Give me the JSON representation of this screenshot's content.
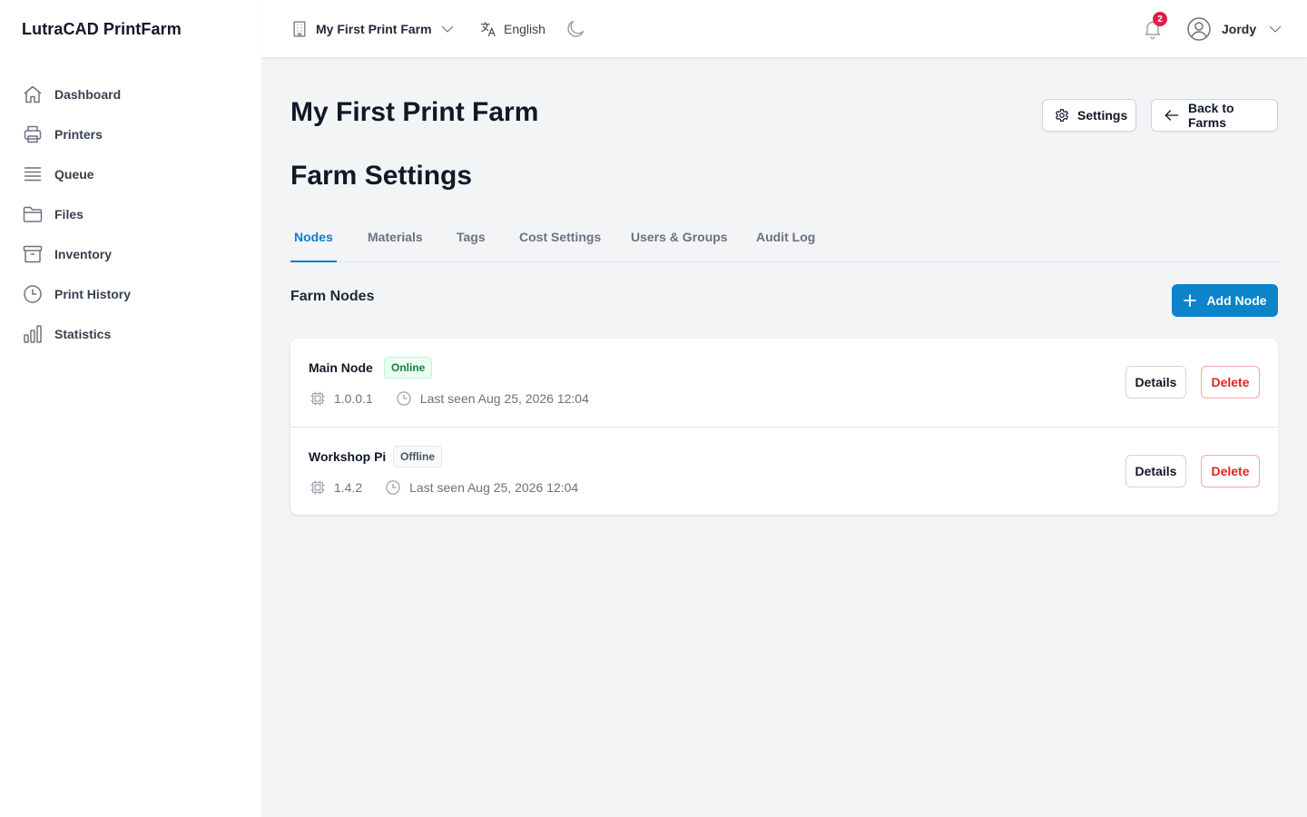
{
  "app": {
    "title": "LutraCAD PrintFarm"
  },
  "sidebar": {
    "items": [
      {
        "label": "Dashboard",
        "icon": "home-icon"
      },
      {
        "label": "Printers",
        "icon": "printer-icon"
      },
      {
        "label": "Queue",
        "icon": "queue-icon"
      },
      {
        "label": "Files",
        "icon": "folder-icon"
      },
      {
        "label": "Inventory",
        "icon": "archive-icon"
      },
      {
        "label": "Print History",
        "icon": "clock-icon"
      },
      {
        "label": "Statistics",
        "icon": "bar-chart-icon"
      }
    ]
  },
  "topbar": {
    "farm_selector": "My First Print Farm",
    "language": "English",
    "notifications_count": "2",
    "user_name": "Jordy"
  },
  "page": {
    "title": "My First Print Farm",
    "settings_label": "Settings",
    "back_label": "Back to Farms",
    "section_title": "Farm Settings"
  },
  "tabs": [
    {
      "label": "Nodes",
      "active": true
    },
    {
      "label": "Materials",
      "active": false
    },
    {
      "label": "Tags",
      "active": false
    },
    {
      "label": "Cost Settings",
      "active": false
    },
    {
      "label": "Users & Groups",
      "active": false
    },
    {
      "label": "Audit Log",
      "active": false
    }
  ],
  "nodes_section": {
    "heading": "Farm Nodes",
    "add_label": "Add Node"
  },
  "nodes": [
    {
      "name": "Main Node",
      "status": "Online",
      "version": "1.0.0.1",
      "last_seen": "Last seen Aug 25, 2026 12:04",
      "details_label": "Details",
      "delete_label": "Delete"
    },
    {
      "name": "Workshop Pi",
      "status": "Offline",
      "version": "1.4.2",
      "last_seen": "Last seen Aug 25, 2026 12:04",
      "details_label": "Details",
      "delete_label": "Delete"
    }
  ],
  "colors": {
    "accent": "#0b84c9",
    "online": "#15803d",
    "delete": "#dc2626",
    "notification_badge": "#e11d48"
  }
}
